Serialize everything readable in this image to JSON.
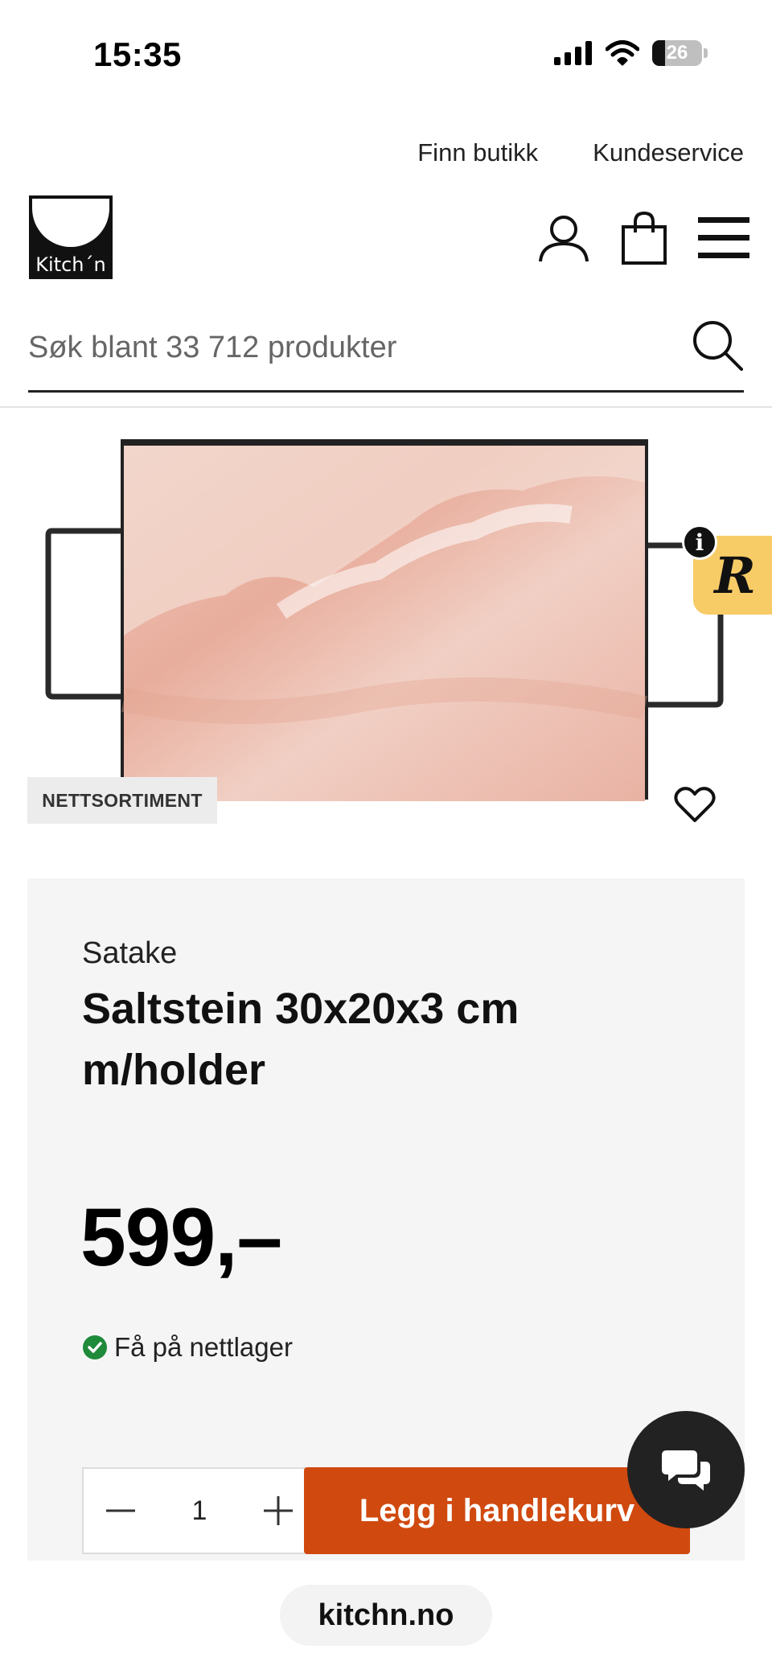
{
  "status_bar": {
    "time": "15:35",
    "battery": "26",
    "battery_level": 0.26
  },
  "top_links": {
    "find_store": "Finn butikk",
    "customer_service": "Kundeservice"
  },
  "header": {
    "logo_text": "Kitch´n",
    "icons": [
      "user-icon",
      "shopping-bag-icon",
      "menu-icon"
    ]
  },
  "search": {
    "placeholder": "Søk blant 33 712 produkter",
    "value": ""
  },
  "product": {
    "badge": "NETTSORTIMENT",
    "brand": "Satake",
    "title": "Saltstein 30x20x3 cm m/holder",
    "price": "599,–",
    "stock": "Få på nettlager",
    "quantity": "1",
    "add_to_cart": "Legg i handlekurv"
  },
  "widgets": {
    "review_letter": "R",
    "info_letter": "i"
  },
  "browser": {
    "url": "kitchn.no"
  },
  "colors": {
    "cart_button": "#d0490f",
    "review_widget": "#f7cb66",
    "stock_check": "#1f8a3a"
  }
}
